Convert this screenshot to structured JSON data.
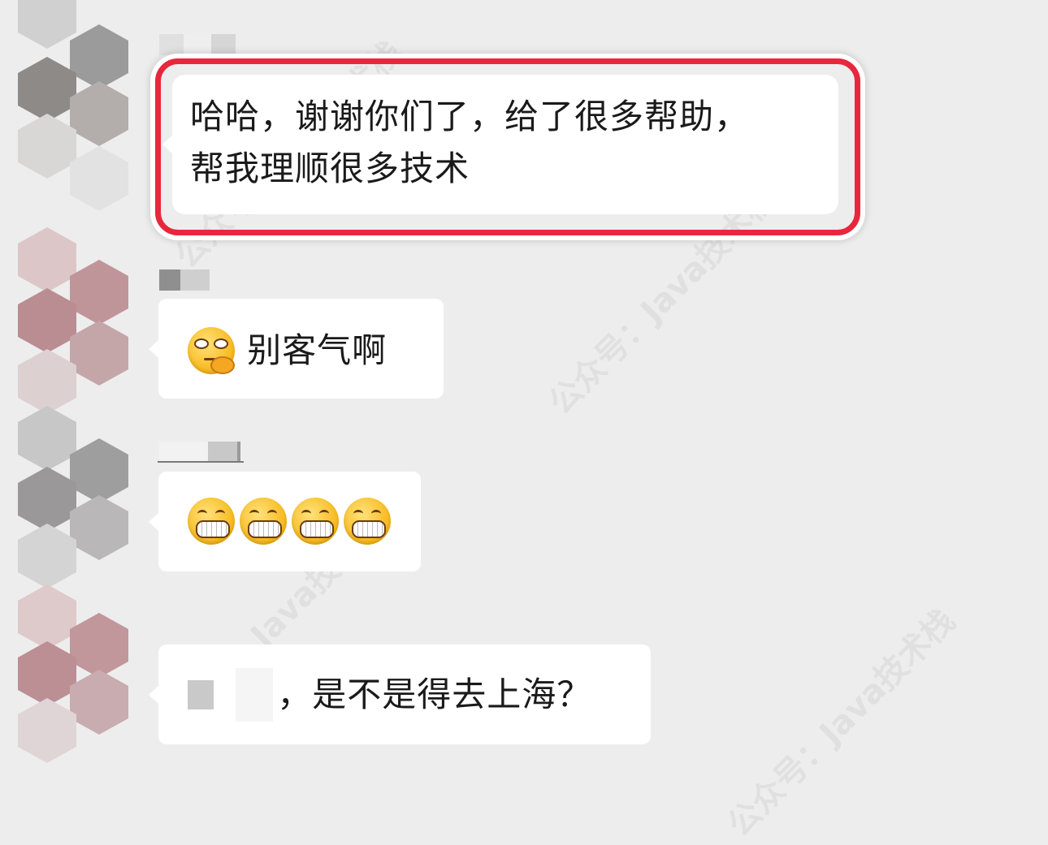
{
  "watermark": "公众号：Java技术栈",
  "messages": [
    {
      "text_line1": "哈哈，谢谢你们了，给了很多帮助，",
      "text_line2": "帮我理顺很多技术"
    },
    {
      "emoji": "thinking-face-icon",
      "text": "别客气啊"
    },
    {
      "emojis": [
        "grinning-face-icon",
        "grinning-face-icon",
        "grinning-face-icon",
        "grinning-face-icon"
      ]
    },
    {
      "text": "，是不是得去上海？"
    }
  ],
  "colors": {
    "background": "#ededed",
    "bubble": "#ffffff",
    "highlight_ring": "#e8273c"
  }
}
